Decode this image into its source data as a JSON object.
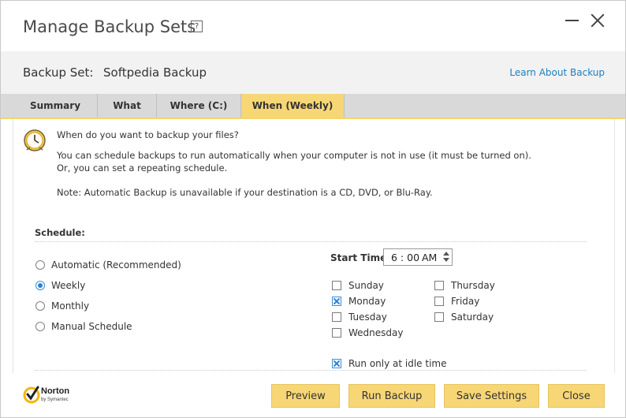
{
  "window": {
    "title": "Manage Backup Sets",
    "help_glyph": "?"
  },
  "backup_set": {
    "label": "Backup Set:",
    "name": "Softpedia Backup",
    "learn_link": "Learn About Backup"
  },
  "tabs": [
    {
      "label": "Summary",
      "active": false
    },
    {
      "label": "What",
      "active": false
    },
    {
      "label": "Where (C:)",
      "active": false
    },
    {
      "label": "When (Weekly)",
      "active": true
    }
  ],
  "intro": {
    "question": "When do you want to backup your files?",
    "line1": "You can schedule backups to run automatically when your computer is not in use (it must be turned on).",
    "line2": "Or, you can set a repeating schedule.",
    "note": "Note: Automatic Backup is unavailable if your destination is a CD, DVD, or Blu-Ray."
  },
  "schedule": {
    "label": "Schedule:",
    "options": [
      {
        "label": "Automatic (Recommended)",
        "selected": false
      },
      {
        "label": "Weekly",
        "selected": true
      },
      {
        "label": "Monthly",
        "selected": false
      },
      {
        "label": "Manual Schedule",
        "selected": false
      }
    ],
    "start_time_label": "Start Time:",
    "start_time": "6 : 00",
    "ampm": "AM",
    "days": [
      {
        "label": "Sunday",
        "checked": false
      },
      {
        "label": "Monday",
        "checked": true
      },
      {
        "label": "Tuesday",
        "checked": false
      },
      {
        "label": "Wednesday",
        "checked": false
      },
      {
        "label": "Thursday",
        "checked": false
      },
      {
        "label": "Friday",
        "checked": false
      },
      {
        "label": "Saturday",
        "checked": false
      }
    ],
    "idle_label": "Run only at idle time",
    "idle_checked": true
  },
  "footer": {
    "brand": "Norton",
    "brand_sub": "by Symantec",
    "buttons": {
      "preview": "Preview",
      "run": "Run Backup",
      "save": "Save Settings",
      "close": "Close"
    }
  },
  "colors": {
    "accent_yellow": "#f7d675",
    "link_blue": "#1a7fc1",
    "check_blue": "#2f7fd0"
  }
}
